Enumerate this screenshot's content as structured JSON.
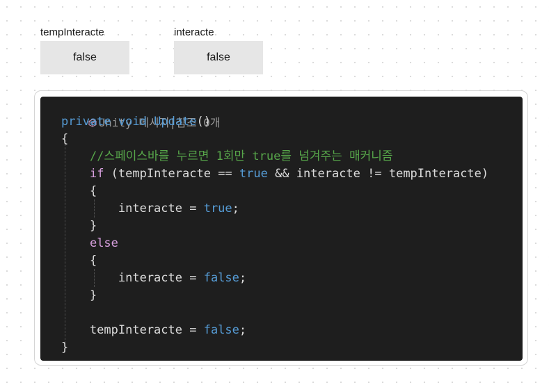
{
  "variables": [
    {
      "name": "tempInteracte",
      "value": "false"
    },
    {
      "name": "interacte",
      "value": "false"
    }
  ],
  "code": {
    "codelens": {
      "icon": "unity-cube-icon",
      "text": "Unity 메시지|참조 0개"
    },
    "lines": [
      [
        {
          "t": "private",
          "c": "kw"
        },
        {
          "t": " ",
          "c": "pl"
        },
        {
          "t": "void",
          "c": "kw"
        },
        {
          "t": " ",
          "c": "pl"
        },
        {
          "t": "Update",
          "c": "fn"
        },
        {
          "t": "()",
          "c": "pl"
        }
      ],
      [
        {
          "t": "{",
          "c": "pl"
        }
      ],
      [
        {
          "t": "    ",
          "c": "pl"
        },
        {
          "t": "//스페이스바를 누르면 1회만 true를 넘겨주는 매커니즘",
          "c": "cm"
        }
      ],
      [
        {
          "t": "    ",
          "c": "pl"
        },
        {
          "t": "if",
          "c": "ctl"
        },
        {
          "t": " (tempInteracte == ",
          "c": "pl"
        },
        {
          "t": "true",
          "c": "kw"
        },
        {
          "t": " && interacte != tempInteracte)",
          "c": "pl"
        }
      ],
      [
        {
          "t": "    {",
          "c": "pl"
        }
      ],
      [
        {
          "t": "        interacte = ",
          "c": "pl"
        },
        {
          "t": "true",
          "c": "kw"
        },
        {
          "t": ";",
          "c": "pl"
        }
      ],
      [
        {
          "t": "    }",
          "c": "pl"
        }
      ],
      [
        {
          "t": "    ",
          "c": "pl"
        },
        {
          "t": "else",
          "c": "ctl"
        }
      ],
      [
        {
          "t": "    {",
          "c": "pl"
        }
      ],
      [
        {
          "t": "        interacte = ",
          "c": "pl"
        },
        {
          "t": "false",
          "c": "kw"
        },
        {
          "t": ";",
          "c": "pl"
        }
      ],
      [
        {
          "t": "    }",
          "c": "pl"
        }
      ],
      [
        {
          "t": "",
          "c": "pl"
        }
      ],
      [
        {
          "t": "    tempInteracte = ",
          "c": "pl"
        },
        {
          "t": "false",
          "c": "kw"
        },
        {
          "t": ";",
          "c": "pl"
        }
      ],
      [
        {
          "t": "}",
          "c": "pl"
        }
      ]
    ]
  },
  "colors": {
    "keyword": "#569cd6",
    "control": "#d8a0df",
    "comment": "#57a64a",
    "plain": "#dcdcdc",
    "codelens": "#999999",
    "editor_bg": "#1e1e1e",
    "value_box_bg": "#e6e6e6"
  }
}
